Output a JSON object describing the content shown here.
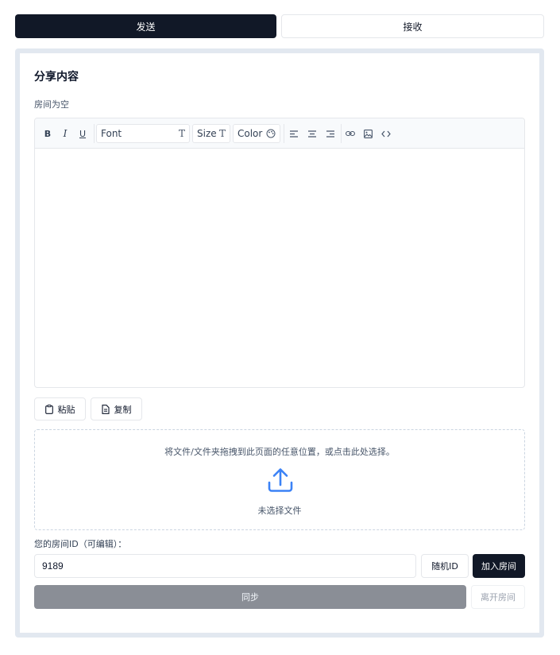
{
  "tabs": {
    "send": "发送",
    "receive": "接收"
  },
  "share": {
    "title": "分享内容",
    "room_status": "房间为空"
  },
  "toolbar": {
    "bold": "B",
    "italic": "I",
    "underline": "U",
    "font_label": "Font",
    "size_label": "Size",
    "color_label": "Color"
  },
  "actions": {
    "paste": "粘贴",
    "copy": "复制"
  },
  "dropzone": {
    "hint": "将文件/文件夹拖拽到此页面的任意位置，或点击此处选择。",
    "status": "未选择文件"
  },
  "room": {
    "label": "您的房间ID（可编辑）：",
    "id_value": "9189",
    "random_button": "随机ID",
    "join_button": "加入房间",
    "sync_button": "同步",
    "leave_button": "离开房间"
  },
  "colors": {
    "primary": "#111827",
    "accent": "#3b82f6",
    "sync_disabled": "#8a8e96"
  },
  "icons": [
    "bold-icon",
    "italic-icon",
    "underline-icon",
    "font-icon",
    "size-icon",
    "palette-icon",
    "align-left-icon",
    "align-center-icon",
    "align-right-icon",
    "link-icon",
    "image-icon",
    "code-icon",
    "clipboard-icon",
    "document-icon",
    "upload-icon"
  ]
}
